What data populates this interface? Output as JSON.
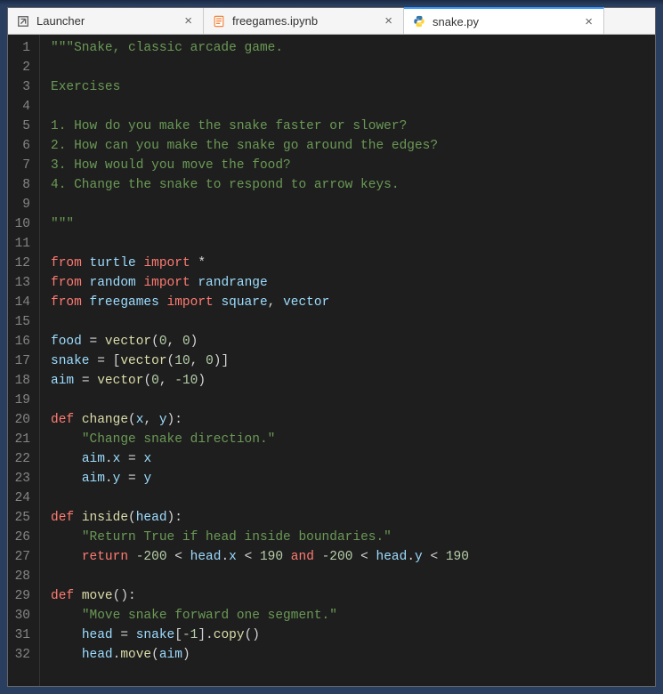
{
  "tabs": [
    {
      "label": "Launcher",
      "icon": "launcher-icon",
      "active": false
    },
    {
      "label": "freegames.ipynb",
      "icon": "notebook-icon",
      "active": false
    },
    {
      "label": "snake.py",
      "icon": "python-icon",
      "active": true
    }
  ],
  "close_glyph": "×",
  "code": {
    "lines": [
      {
        "n": 1,
        "tokens": [
          [
            "cs",
            "\"\"\"Snake, classic arcade game."
          ]
        ]
      },
      {
        "n": 2,
        "tokens": []
      },
      {
        "n": 3,
        "tokens": [
          [
            "cs",
            "Exercises"
          ]
        ]
      },
      {
        "n": 4,
        "tokens": []
      },
      {
        "n": 5,
        "tokens": [
          [
            "cs",
            "1. How do you make the snake faster or slower?"
          ]
        ]
      },
      {
        "n": 6,
        "tokens": [
          [
            "cs",
            "2. How can you make the snake go around the edges?"
          ]
        ]
      },
      {
        "n": 7,
        "tokens": [
          [
            "cs",
            "3. How would you move the food?"
          ]
        ]
      },
      {
        "n": 8,
        "tokens": [
          [
            "cs",
            "4. Change the snake to respond to arrow keys."
          ]
        ]
      },
      {
        "n": 9,
        "tokens": []
      },
      {
        "n": 10,
        "tokens": [
          [
            "cs",
            "\"\"\""
          ]
        ]
      },
      {
        "n": 11,
        "tokens": []
      },
      {
        "n": 12,
        "tokens": [
          [
            "from",
            "from "
          ],
          [
            "nm",
            "turtle "
          ],
          [
            "imp",
            "import "
          ],
          [
            "star",
            "*"
          ]
        ]
      },
      {
        "n": 13,
        "tokens": [
          [
            "from",
            "from "
          ],
          [
            "nm",
            "random "
          ],
          [
            "imp",
            "import "
          ],
          [
            "nm",
            "randrange"
          ]
        ]
      },
      {
        "n": 14,
        "tokens": [
          [
            "from",
            "from "
          ],
          [
            "nm",
            "freegames "
          ],
          [
            "imp",
            "import "
          ],
          [
            "nm",
            "square"
          ],
          [
            "pu",
            ", "
          ],
          [
            "nm",
            "vector"
          ]
        ]
      },
      {
        "n": 15,
        "tokens": []
      },
      {
        "n": 16,
        "tokens": [
          [
            "nm",
            "food "
          ],
          [
            "op",
            "= "
          ],
          [
            "fn",
            "vector"
          ],
          [
            "pu",
            "("
          ],
          [
            "num",
            "0"
          ],
          [
            "pu",
            ", "
          ],
          [
            "num",
            "0"
          ],
          [
            "pu",
            ")"
          ]
        ]
      },
      {
        "n": 17,
        "tokens": [
          [
            "nm",
            "snake "
          ],
          [
            "op",
            "= "
          ],
          [
            "pu",
            "["
          ],
          [
            "fn",
            "vector"
          ],
          [
            "pu",
            "("
          ],
          [
            "num",
            "10"
          ],
          [
            "pu",
            ", "
          ],
          [
            "num",
            "0"
          ],
          [
            "pu",
            ")]"
          ]
        ]
      },
      {
        "n": 18,
        "tokens": [
          [
            "nm",
            "aim "
          ],
          [
            "op",
            "= "
          ],
          [
            "fn",
            "vector"
          ],
          [
            "pu",
            "("
          ],
          [
            "num",
            "0"
          ],
          [
            "pu",
            ", "
          ],
          [
            "num",
            "-10"
          ],
          [
            "pu",
            ")"
          ]
        ]
      },
      {
        "n": 19,
        "tokens": []
      },
      {
        "n": 20,
        "tokens": [
          [
            "kw",
            "def "
          ],
          [
            "fn",
            "change"
          ],
          [
            "pu",
            "("
          ],
          [
            "nm",
            "x"
          ],
          [
            "pu",
            ", "
          ],
          [
            "nm",
            "y"
          ],
          [
            "pu",
            "):"
          ]
        ]
      },
      {
        "n": 21,
        "tokens": [
          [
            "pu",
            "    "
          ],
          [
            "cs",
            "\"Change snake direction.\""
          ]
        ]
      },
      {
        "n": 22,
        "tokens": [
          [
            "pu",
            "    "
          ],
          [
            "nm",
            "aim"
          ],
          [
            "pu",
            "."
          ],
          [
            "nm",
            "x "
          ],
          [
            "op",
            "= "
          ],
          [
            "nm",
            "x"
          ]
        ]
      },
      {
        "n": 23,
        "tokens": [
          [
            "pu",
            "    "
          ],
          [
            "nm",
            "aim"
          ],
          [
            "pu",
            "."
          ],
          [
            "nm",
            "y "
          ],
          [
            "op",
            "= "
          ],
          [
            "nm",
            "y"
          ]
        ]
      },
      {
        "n": 24,
        "tokens": []
      },
      {
        "n": 25,
        "tokens": [
          [
            "kw",
            "def "
          ],
          [
            "fn",
            "inside"
          ],
          [
            "pu",
            "("
          ],
          [
            "nm",
            "head"
          ],
          [
            "pu",
            "):"
          ]
        ]
      },
      {
        "n": 26,
        "tokens": [
          [
            "pu",
            "    "
          ],
          [
            "cs",
            "\"Return True if head inside boundaries.\""
          ]
        ]
      },
      {
        "n": 27,
        "tokens": [
          [
            "pu",
            "    "
          ],
          [
            "kw",
            "return "
          ],
          [
            "num",
            "-200 "
          ],
          [
            "op",
            "< "
          ],
          [
            "nm",
            "head"
          ],
          [
            "pu",
            "."
          ],
          [
            "nm",
            "x "
          ],
          [
            "op",
            "< "
          ],
          [
            "num",
            "190 "
          ],
          [
            "kw",
            "and "
          ],
          [
            "num",
            "-200 "
          ],
          [
            "op",
            "< "
          ],
          [
            "nm",
            "head"
          ],
          [
            "pu",
            "."
          ],
          [
            "nm",
            "y "
          ],
          [
            "op",
            "< "
          ],
          [
            "num",
            "190"
          ]
        ]
      },
      {
        "n": 28,
        "tokens": []
      },
      {
        "n": 29,
        "tokens": [
          [
            "kw",
            "def "
          ],
          [
            "fn",
            "move"
          ],
          [
            "pu",
            "():"
          ]
        ]
      },
      {
        "n": 30,
        "tokens": [
          [
            "pu",
            "    "
          ],
          [
            "cs",
            "\"Move snake forward one segment.\""
          ]
        ]
      },
      {
        "n": 31,
        "tokens": [
          [
            "pu",
            "    "
          ],
          [
            "nm",
            "head "
          ],
          [
            "op",
            "= "
          ],
          [
            "nm",
            "snake"
          ],
          [
            "pu",
            "["
          ],
          [
            "num",
            "-1"
          ],
          [
            "pu",
            "]."
          ],
          [
            "fn",
            "copy"
          ],
          [
            "pu",
            "()"
          ]
        ]
      },
      {
        "n": 32,
        "tokens": [
          [
            "pu",
            "    "
          ],
          [
            "nm",
            "head"
          ],
          [
            "pu",
            "."
          ],
          [
            "fn",
            "move"
          ],
          [
            "pu",
            "("
          ],
          [
            "nm",
            "aim"
          ],
          [
            "pu",
            ")"
          ]
        ]
      }
    ]
  }
}
